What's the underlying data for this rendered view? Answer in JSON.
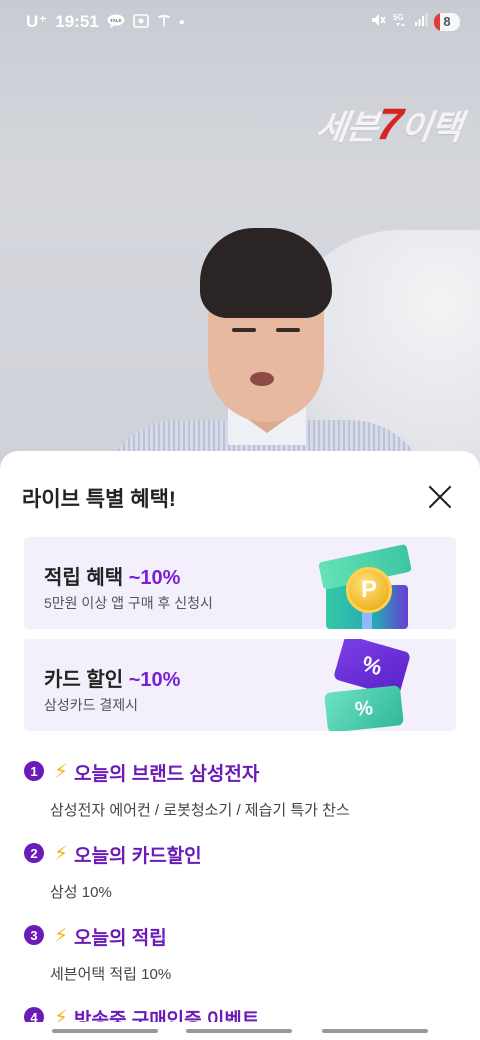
{
  "status_bar": {
    "carrier": "U⁺",
    "time": "19:51",
    "battery": "8",
    "left_icons": [
      "talk-icon",
      "screenshot-icon",
      "tesla-icon",
      "dot-icon"
    ],
    "right_icons": [
      "mute-icon",
      "5g-icon",
      "signal-icon",
      "battery-icon"
    ],
    "talk_label": "TALK",
    "net_label": "5G"
  },
  "video": {
    "logo_text_a": "세븐",
    "logo_text_seven": "7",
    "logo_text_b": "이택"
  },
  "sheet": {
    "title": "라이브 특별 혜택!",
    "cards": [
      {
        "title": "적립 혜택",
        "highlight": "~10%",
        "subtitle": "5만원 이상 앱 구매 후 신청시",
        "graphic": "gift-coin",
        "coin_label": "P"
      },
      {
        "title": "카드 할인",
        "highlight": "~10%",
        "subtitle": "삼성카드 결제시",
        "graphic": "coupon",
        "coupon_label": "%"
      }
    ],
    "items": [
      {
        "num": "1",
        "title": "오늘의 브랜드 삼성전자",
        "desc": "삼성전자 에어컨 / 로봇청소기 / 제습기 특가 찬스"
      },
      {
        "num": "2",
        "title": "오늘의 카드할인",
        "desc": "삼성 10%"
      },
      {
        "num": "3",
        "title": "오늘의 적립",
        "desc": "세븐어택 적립 10%"
      },
      {
        "num": "4",
        "title": "방송중 구매인증 이벤트",
        "desc": ""
      }
    ],
    "bolt": "⚡"
  },
  "colors": {
    "accent": "#6a1bb8",
    "highlight": "#7a1fd6",
    "card_bg": "#f4f0fb"
  }
}
